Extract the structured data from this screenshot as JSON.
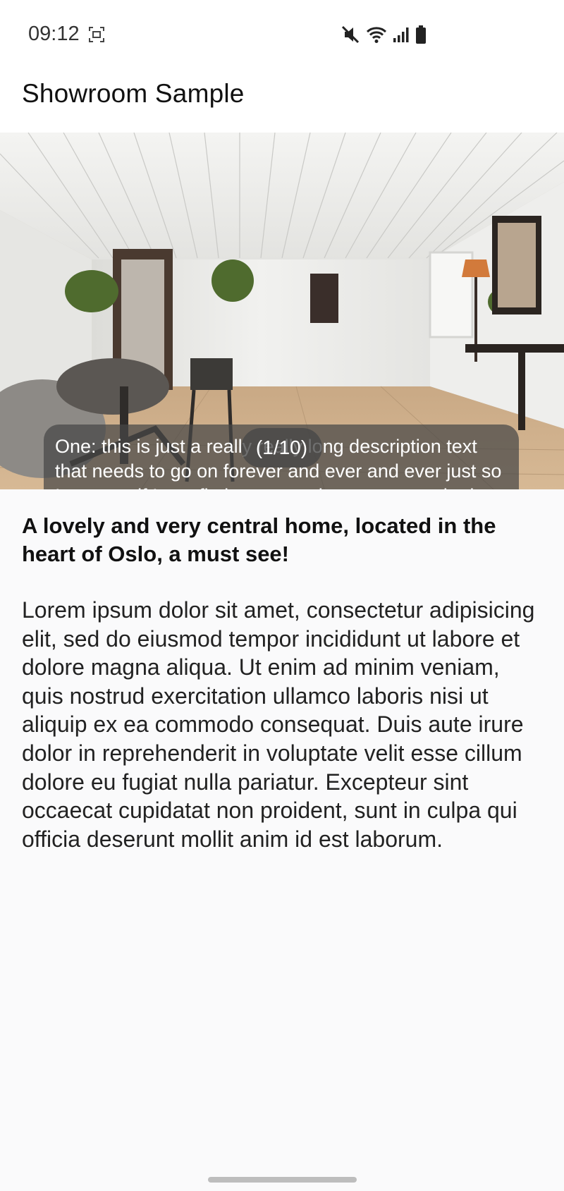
{
  "status_bar": {
    "time": "09:12",
    "icons": [
      "screenshot-icon",
      "mute-icon",
      "wifi-icon",
      "signal-icon",
      "battery-icon"
    ]
  },
  "app_bar": {
    "title": "Showroom Sample"
  },
  "gallery": {
    "caption": "One: this is just a really really long description text that needs to go on forever and ever and ever just so I can see if I can fit the text on the screen or whether it doens't actually fit.",
    "counter": "(1/10)"
  },
  "listing": {
    "headline": "A lovely and very central home, located in the heart of Oslo, a must see!",
    "description": "Lorem ipsum dolor sit amet, consectetur adipisicing elit, sed do eiusmod tempor incididunt ut labore et dolore magna aliqua. Ut enim ad minim veniam, quis nostrud exercitation ullamco laboris nisi ut aliquip ex ea commodo consequat. Duis aute irure dolor in reprehenderit in voluptate velit esse cillum dolore eu fugiat nulla pariatur. Excepteur sint occaecat cupidatat non proident, sunt in culpa qui officia deserunt mollit anim id est laborum."
  },
  "colors": {
    "background": "#fafafb",
    "overlay": "#464646",
    "text": "#111111"
  }
}
